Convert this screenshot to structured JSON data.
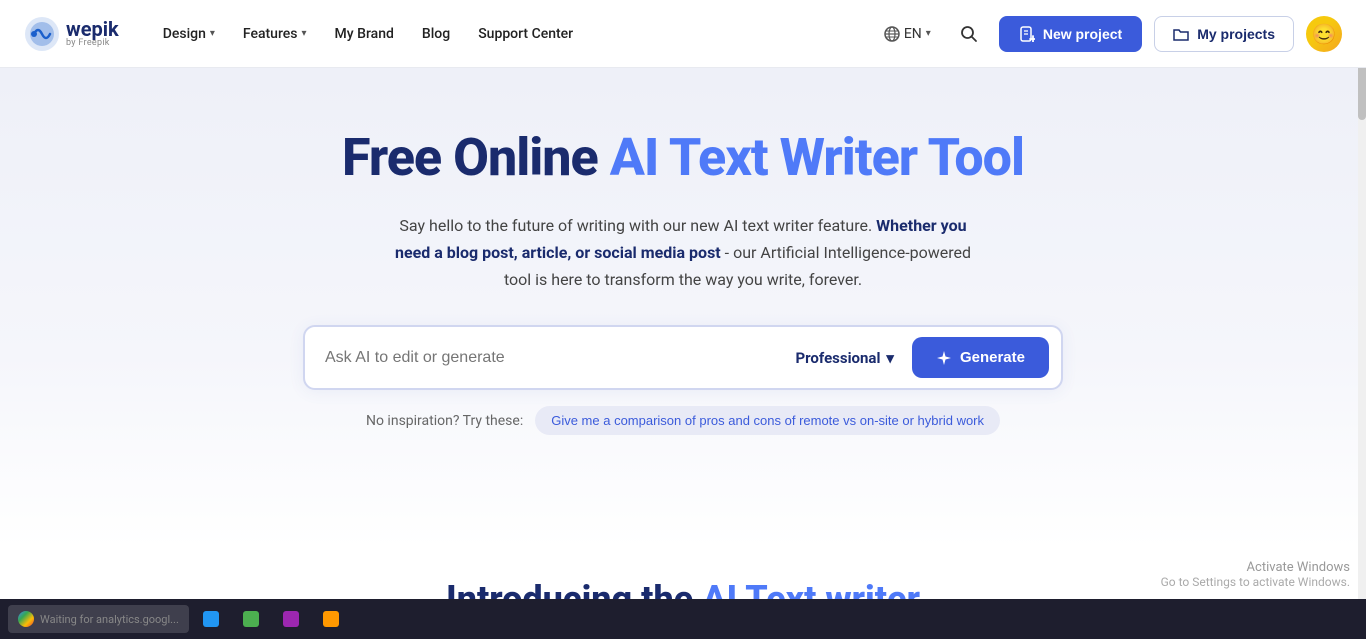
{
  "brand": {
    "name": "wepik",
    "tagline": "by Freepik",
    "logo_emoji": "🔵"
  },
  "navbar": {
    "design_label": "Design",
    "features_label": "Features",
    "mybrand_label": "My Brand",
    "blog_label": "Blog",
    "support_label": "Support Center",
    "lang_label": "EN",
    "new_project_label": "New project",
    "my_projects_label": "My projects"
  },
  "hero": {
    "title_part1": "Free Online ",
    "title_part2": "AI Text Writer Tool",
    "subtitle_plain1": "Say hello to the future of writing with our new AI text writer feature. ",
    "subtitle_bold": "Whether you need a blog post, article, or social media post",
    "subtitle_plain2": " - our Artificial Intelligence-powered tool is here to transform the way you write, forever."
  },
  "ai_input": {
    "placeholder": "Ask AI to edit or generate",
    "tone_label": "Professional",
    "generate_label": "Generate"
  },
  "suggestions": {
    "label": "No inspiration? Try these:",
    "chips": [
      "Give me a comparison of pros and cons of remote vs on-site or hybrid work"
    ]
  },
  "bottom": {
    "title_part1": "Introducing the ",
    "title_part2": "AI Text writer"
  },
  "activate_windows": {
    "title": "Activate Windows",
    "subtitle": "Go to Settings to activate Windows."
  },
  "taskbar": {
    "status_text": "Waiting for analytics.googl..."
  }
}
